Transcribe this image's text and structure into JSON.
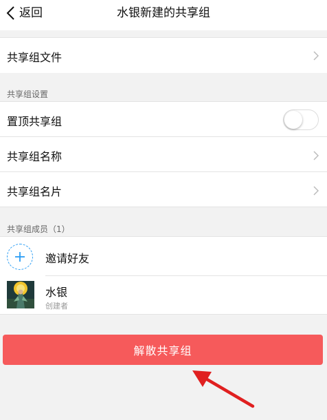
{
  "navbar": {
    "back_label": "返回",
    "title": "水银新建的共享组",
    "back_icon": "chevron-left-icon"
  },
  "files": {
    "label": "共享组文件"
  },
  "settings": {
    "header": "共享组设置",
    "pin_label": "置顶共享组",
    "pin_enabled": false,
    "name_label": "共享组名称",
    "card_label": "共享组名片"
  },
  "members": {
    "header": "共享组成员（1）",
    "invite_label": "邀请好友",
    "list": [
      {
        "name": "水银",
        "role": "创建者"
      }
    ]
  },
  "dissolve": {
    "label": "解散共享组"
  },
  "colors": {
    "accent_red": "#f65a5b",
    "invite_blue": "#2a9df4",
    "annotation_arrow": "#e02020"
  }
}
